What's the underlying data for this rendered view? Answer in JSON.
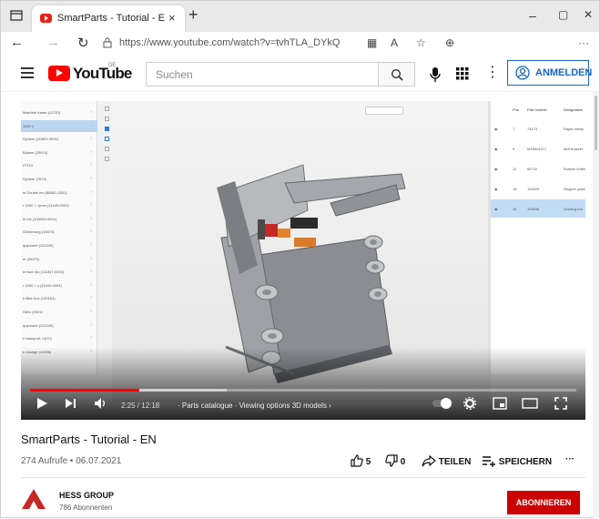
{
  "browser": {
    "tab_title": "SmartParts - Tutorial - EN - YouT",
    "tab_close": "×",
    "new_tab": "+",
    "url": "https://www.youtube.com/watch?v=tvhTLA_DYkQ",
    "minimize": "–",
    "maximize": "▢",
    "close": "✕",
    "more": "···"
  },
  "header": {
    "logo_text": "YouTube",
    "country": "DE",
    "search_placeholder": "Suchen",
    "signin_label": "ANMELDEN",
    "menu_dots": "⋮"
  },
  "video": {
    "left_tree": [
      "Machine frame (11720)",
      "1000 k",
      "System (11500+3001)",
      "Bolzen (20914)",
      "27113",
      "System (7874)",
      "ie Double mo (88681-0001)",
      "r 1000 + c(mm (11449-0002)",
      "ie mo (103028-0001)",
      "Gliederung (10073)",
      "quipment (102240)",
      "er (26270)",
      "ie face mo (111847-0002)",
      "r 1000 + c (11449-0003)",
      "e filter box (100151)",
      "Stein (0001)",
      "quipment (102240)",
      "e transport, m(70)",
      "e change (10296)"
    ],
    "right_headers": [
      "Pos.",
      "Part number",
      "Designation"
    ],
    "right_rows": [
      [
        "7",
        "74173",
        "Rapid clamp"
      ],
      [
        "9",
        "MZ5001071",
        "Belt bracket"
      ],
      [
        "12",
        "69732",
        "Rubber buffer"
      ],
      [
        "16",
        "100025",
        "Stopper plate"
      ],
      [
        "26",
        "100046",
        "Guiding rod"
      ]
    ],
    "time_text": "2:25 / 12:18",
    "chapter_text": "· Parts catalogue · Viewing options 3D models ›",
    "progress": 0.2,
    "buffered": 0.36
  },
  "info": {
    "title": "SmartParts - Tutorial - EN",
    "meta": "274 Aufrufe • 06.07.2021",
    "likes": "5",
    "dislikes": "0",
    "share": "TEILEN",
    "save": "SPEICHERN",
    "more": "···",
    "channel_name": "HESS GROUP",
    "subscribers": "786 Abonnenten",
    "subscribe": "ABONNIEREN"
  },
  "colors": {
    "brand_red": "#ff0000",
    "subscribe_red": "#cc0000",
    "link_blue": "#1565c0"
  }
}
